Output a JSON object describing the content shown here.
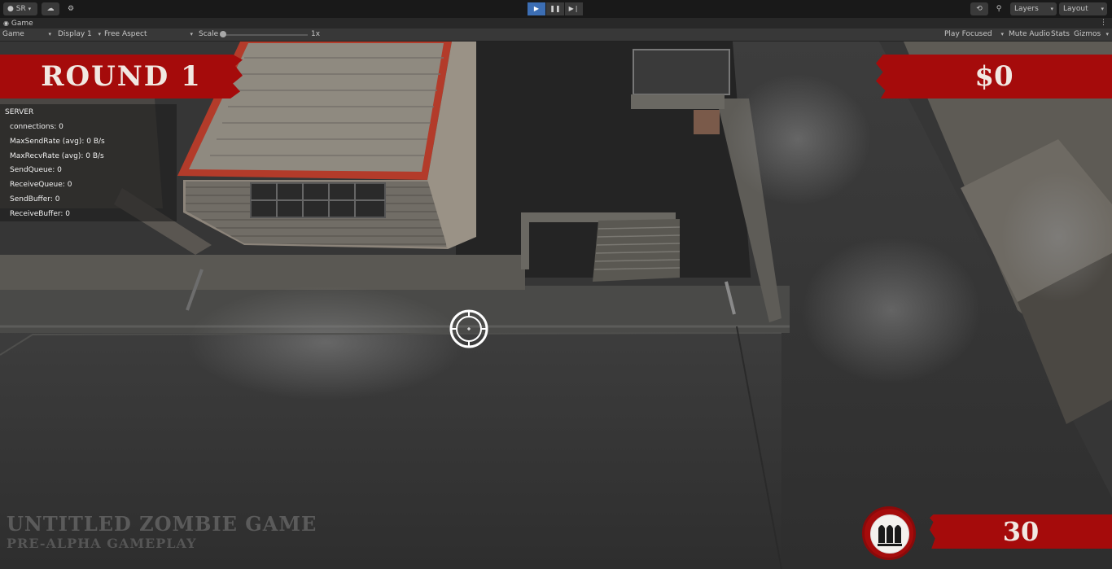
{
  "toolbar": {
    "account_label": "SR",
    "layers_label": "Layers",
    "layout_label": "Layout"
  },
  "tab": {
    "title": "Game"
  },
  "gamebar": {
    "view_mode": "Game",
    "display": "Display 1",
    "aspect": "Free Aspect",
    "scale_label": "Scale",
    "scale_value": "1x",
    "play_mode": "Play Focused",
    "mute_audio": "Mute Audio",
    "stats": "Stats",
    "gizmos": "Gizmos"
  },
  "hud": {
    "round": "ROUND 1",
    "money": "$0",
    "ammo": "30"
  },
  "server": {
    "title": "SERVER",
    "lines": [
      "connections: 0",
      "MaxSendRate (avg): 0 B/s",
      "MaxRecvRate (avg): 0 B/s",
      "SendQueue: 0",
      "ReceiveQueue: 0",
      "SendBuffer: 0",
      "ReceiveBuffer: 0"
    ]
  },
  "watermark": {
    "title": "UNTITLED ZOMBIE GAME",
    "subtitle": "PRE-ALPHA GAMEPLAY"
  },
  "colors": {
    "hud_red": "#a50b0b",
    "play_active": "#3c6eb4",
    "editor_dark": "#191919"
  }
}
